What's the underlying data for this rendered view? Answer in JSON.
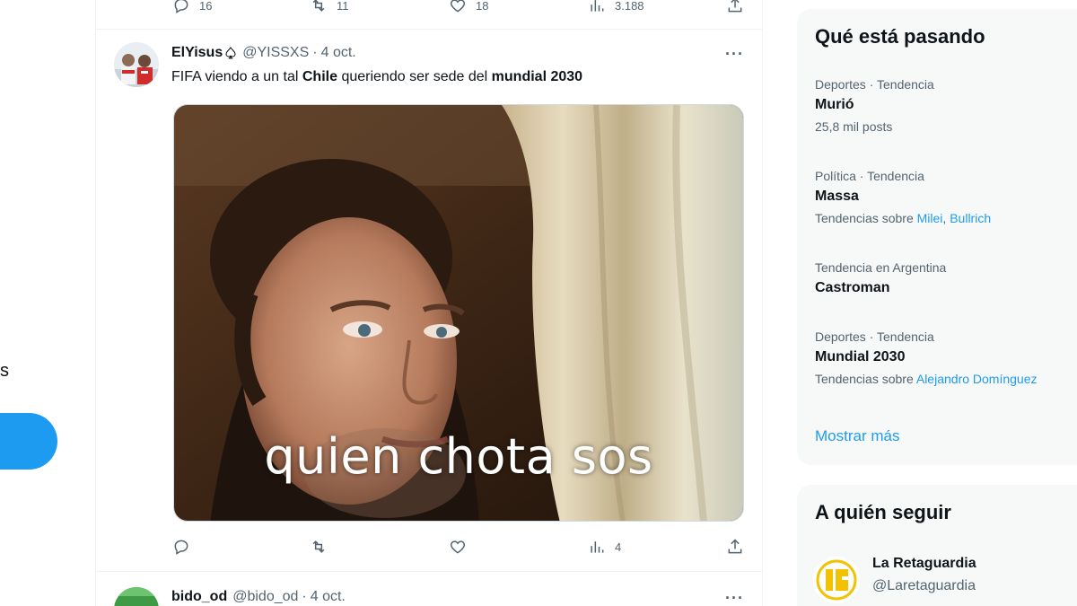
{
  "sidebar": {
    "partial_label": "s"
  },
  "prev_tweet": {
    "replies": "16",
    "retweets": "11",
    "likes": "18",
    "views": "3.188"
  },
  "tweet": {
    "name": "ElYisus",
    "name_icon": "spade-icon",
    "handle": "@YISSXS",
    "separator": "·",
    "time": "4 oct.",
    "more": "···",
    "text_parts": [
      "FIFA viendo a un tal ",
      "Chile",
      " queriendo ser sede del ",
      "mundial 2030"
    ],
    "media_caption": "quien chota sos",
    "views": "4"
  },
  "next_tweet": {
    "name": "bido_od",
    "handle": "@bido_od",
    "separator": "·",
    "time": "4 oct.",
    "more": "···"
  },
  "trends": {
    "title": "Qué está pasando",
    "items": [
      {
        "meta": "Deportes · Tendencia",
        "name": "Murió",
        "sub": "25,8 mil posts"
      },
      {
        "meta": "Política · Tendencia",
        "name": "Massa",
        "sub_prefix": "Tendencias sobre ",
        "sub_link1": "Milei",
        "sub_sep": ", ",
        "sub_link2": "Bullrich"
      },
      {
        "meta": "Tendencia en Argentina",
        "name": "Castroman"
      },
      {
        "meta": "Deportes · Tendencia",
        "name": "Mundial 2030",
        "sub_prefix": "Tendencias sobre ",
        "sub_link1": "Alejandro Domínguez"
      }
    ],
    "show_more": "Mostrar más"
  },
  "who_to_follow": {
    "title": "A quién seguir",
    "account": {
      "name": "La Retaguardia",
      "handle": "@Laretaguardia"
    }
  },
  "colors": {
    "accent": "#1d9bf0",
    "muted": "#536471",
    "text": "#0f1419",
    "card_bg": "#f7f9f9"
  }
}
